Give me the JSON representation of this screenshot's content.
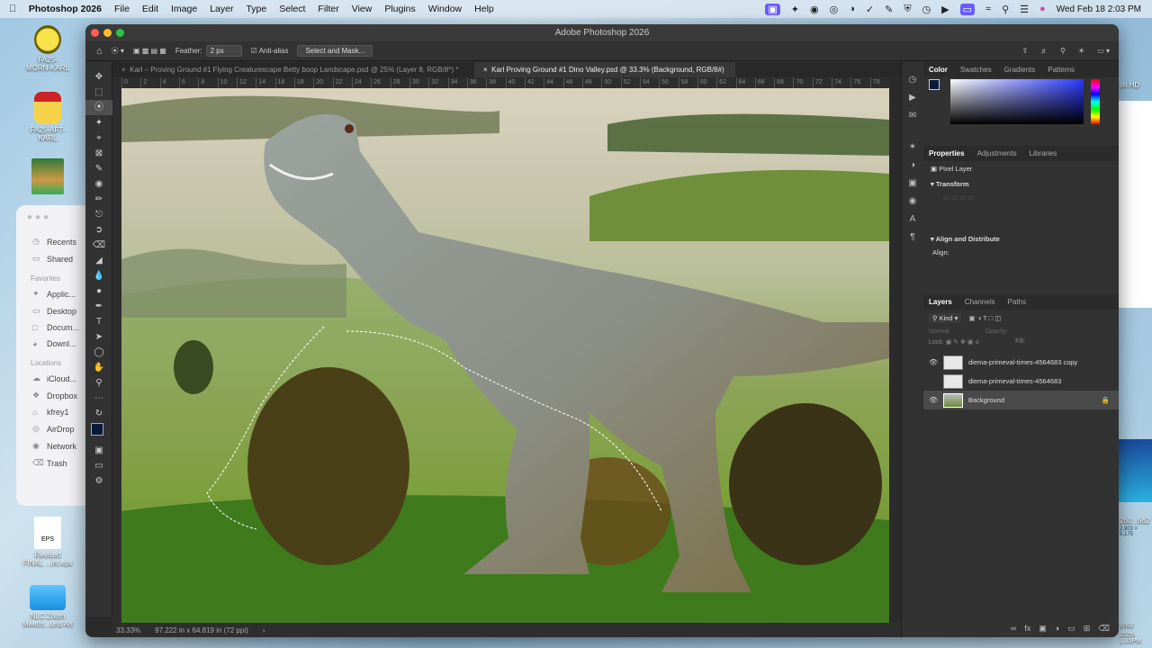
{
  "menubar": {
    "app_name": "Photoshop 2026",
    "items": [
      "File",
      "Edit",
      "Image",
      "Layer",
      "Type",
      "Select",
      "Filter",
      "View",
      "Plugins",
      "Window",
      "Help"
    ],
    "clock": "Wed Feb 18  2:03 PM",
    "status_icons": [
      "screen-record-icon",
      "cursor-icon",
      "robot-icon",
      "ghost-icon",
      "chrome-icon",
      "check-icon",
      "vector-icon",
      "shield-icon",
      "history-icon",
      "play-icon",
      "screen-mirror-icon",
      "wifi-icon",
      "search-icon",
      "control-center-icon",
      "siri-icon"
    ]
  },
  "desktop": {
    "icons": [
      {
        "label": "FA25-\nMORN-KARL"
      },
      {
        "label": "FA25-AFT-\nKARL"
      },
      {
        "label": ""
      },
      {
        "label": "Revised\nFINAL ...int.eps"
      },
      {
        "label": "NLC Zoom\nMeetin...und Art"
      }
    ],
    "eps_badge": "EPS",
    "right_partial": {
      "label1": "sh HD",
      "label2": "260...562",
      "label3": "2,903 × 5,175",
      "label4": "shot",
      "label5": "2025-1.31PM"
    }
  },
  "finder": {
    "items": [
      "Recents",
      "Shared"
    ],
    "favorites_header": "Favorites",
    "favorites": [
      "Applic...",
      "Desktop",
      "Docum...",
      "Downl..."
    ],
    "locations_header": "Locations",
    "locations": [
      "iCloud...",
      "Dropbox",
      "kfrey1",
      "AirDrop",
      "Network",
      "Trash"
    ]
  },
  "photoshop": {
    "window_title": "Adobe Photoshop 2026",
    "options": {
      "feather_label": "Feather:",
      "feather_value": "2 px",
      "antialias_label": "Anti-alias",
      "select_mask_label": "Select and Mask..."
    },
    "tabs": [
      {
        "label": "Karl – Proving Ground #1 Flying Creaturescape Betty boop Landscape.psd @ 25% (Layer 8, RGB/8*) *",
        "active": false
      },
      {
        "label": "Karl Proving Ground #1 Dino Valley.psd @ 33.3% (Background, RGB/8#)",
        "active": true
      }
    ],
    "ruler_ticks": [
      "0",
      "2",
      "4",
      "6",
      "8",
      "10",
      "12",
      "14",
      "16",
      "18",
      "20",
      "22",
      "24",
      "26",
      "28",
      "30",
      "32",
      "34",
      "36",
      "38",
      "40",
      "42",
      "44",
      "46",
      "48",
      "50",
      "52",
      "54",
      "56",
      "58",
      "60",
      "62",
      "64",
      "66",
      "68",
      "70",
      "72",
      "74",
      "76",
      "78"
    ],
    "status": {
      "zoom": "33.33%",
      "doc_size": "97.222 in x 64.819 in (72 ppi)"
    },
    "color_panel_tabs": [
      "Color",
      "Swatches",
      "Gradients",
      "Patterns"
    ],
    "properties_tabs": [
      "Properties",
      "Adjustments",
      "Libraries"
    ],
    "properties": {
      "layer_type": "Pixel Layer",
      "transform_header": "Transform",
      "align_header": "Align and Distribute",
      "align_label": "Align:"
    },
    "layers_tabs": [
      "Layers",
      "Channels",
      "Paths"
    ],
    "layers_filter": "Kind",
    "blend_mode": "Normal",
    "opacity_label": "Opacity:",
    "lock_label": "Lock:",
    "fill_label": "Fill:",
    "layers": [
      {
        "name": "diema-primeval-times-4564683 copy",
        "visible": true,
        "locked": false
      },
      {
        "name": "diema-primeval-times-4564683",
        "visible": false,
        "locked": false
      },
      {
        "name": "Background",
        "visible": true,
        "locked": true
      }
    ],
    "tools": [
      "move-tool-icon",
      "marquee-tool-icon",
      "lasso-tool-icon",
      "magic-wand-icon",
      "crop-tool-icon",
      "frame-tool-icon",
      "eyedropper-icon",
      "healing-brush-icon",
      "brush-tool-icon",
      "clone-stamp-icon",
      "history-brush-icon",
      "eraser-icon",
      "gradient-tool-icon",
      "blur-tool-icon",
      "dodge-tool-icon",
      "pen-tool-icon",
      "type-tool-icon",
      "path-select-icon",
      "shape-tool-icon",
      "hand-tool-icon",
      "zoom-tool-icon",
      "more-tools-icon"
    ]
  }
}
